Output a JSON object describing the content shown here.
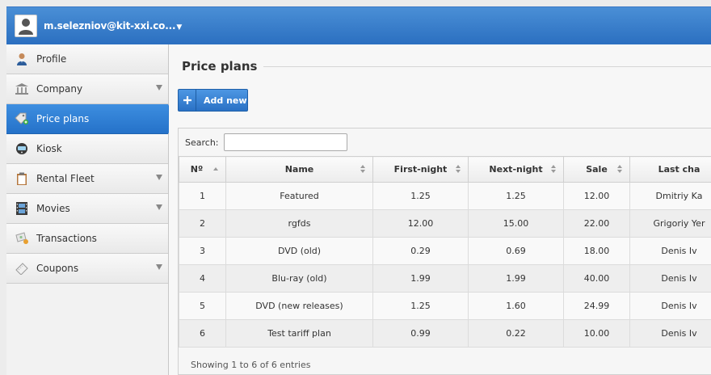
{
  "user": {
    "name": "m.selezniov@kit-xxi.co..."
  },
  "sidebar": {
    "items": [
      {
        "label": "Profile",
        "icon": "person-icon",
        "has_arrow": false,
        "active": false
      },
      {
        "label": "Company",
        "icon": "bank-icon",
        "has_arrow": true,
        "active": false
      },
      {
        "label": "Price plans",
        "icon": "price-tag-icon",
        "has_arrow": false,
        "active": true
      },
      {
        "label": "Kiosk",
        "icon": "kiosk-icon",
        "has_arrow": false,
        "active": false
      },
      {
        "label": "Rental Fleet",
        "icon": "clipboard-icon",
        "has_arrow": true,
        "active": false
      },
      {
        "label": "Movies",
        "icon": "film-icon",
        "has_arrow": true,
        "active": false
      },
      {
        "label": "Transactions",
        "icon": "money-icon",
        "has_arrow": false,
        "active": false
      },
      {
        "label": "Coupons",
        "icon": "coupon-icon",
        "has_arrow": true,
        "active": false
      }
    ]
  },
  "main": {
    "title": "Price plans",
    "add_button": "Add new",
    "search": {
      "label": "Search:",
      "value": ""
    },
    "table": {
      "columns": [
        "Nº",
        "Name",
        "First-night",
        "Next-night",
        "Sale",
        "Last cha"
      ],
      "rows": [
        [
          "1",
          "Featured",
          "1.25",
          "1.25",
          "12.00",
          "Dmitriy Ka"
        ],
        [
          "2",
          "rgfds",
          "12.00",
          "15.00",
          "22.00",
          "Grigoriy Yer"
        ],
        [
          "3",
          "DVD (old)",
          "0.29",
          "0.69",
          "18.00",
          "Denis Iv"
        ],
        [
          "4",
          "Blu-ray (old)",
          "1.99",
          "1.99",
          "40.00",
          "Denis Iv"
        ],
        [
          "5",
          "DVD (new releases)",
          "1.25",
          "1.60",
          "24.99",
          "Denis Iv"
        ],
        [
          "6",
          "Test tariff plan",
          "0.99",
          "0.22",
          "10.00",
          "Denis Iv"
        ]
      ]
    },
    "info": "Showing 1 to 6 of 6 entries"
  },
  "colors": {
    "accent": "#2b74c7",
    "topbar": "#3d85d3"
  }
}
